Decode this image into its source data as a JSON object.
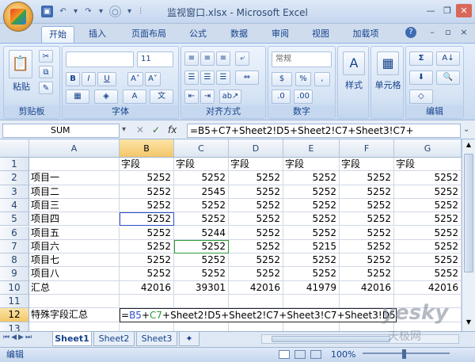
{
  "title": "监视窗口.xlsx - Microsoft Excel",
  "tabs": [
    "开始",
    "插入",
    "页面布局",
    "公式",
    "数据",
    "审阅",
    "视图",
    "加载项"
  ],
  "ribbon": {
    "clipboard": {
      "label": "剪贴板",
      "paste": "粘贴"
    },
    "font": {
      "label": "字体",
      "size": "11"
    },
    "alignment": {
      "label": "对齐方式"
    },
    "number": {
      "label": "数字",
      "format": "常规"
    },
    "styles": {
      "label": "样式"
    },
    "cells": {
      "label": "单元格"
    },
    "editing": {
      "label": "编辑"
    }
  },
  "name_box": "SUM",
  "fx_label": "fx",
  "formula": "=B5+C7+Sheet2!D5+Sheet2!C7+Sheet3!C7+",
  "columns": [
    "A",
    "B",
    "C",
    "D",
    "E",
    "F",
    "G"
  ],
  "rows": [
    {
      "n": "1",
      "a": "",
      "vals": [
        "字段",
        "字段",
        "字段",
        "字段",
        "字段",
        "字段"
      ]
    },
    {
      "n": "2",
      "a": "项目一",
      "vals": [
        "5252",
        "5252",
        "5252",
        "5252",
        "5252",
        "5252"
      ]
    },
    {
      "n": "3",
      "a": "项目二",
      "vals": [
        "5252",
        "2545",
        "5252",
        "5252",
        "5252",
        "5252"
      ]
    },
    {
      "n": "4",
      "a": "项目三",
      "vals": [
        "5252",
        "5252",
        "5252",
        "5252",
        "5252",
        "5252"
      ]
    },
    {
      "n": "5",
      "a": "项目四",
      "vals": [
        "5252",
        "5252",
        "5252",
        "5252",
        "5252",
        "5252"
      ]
    },
    {
      "n": "6",
      "a": "项目五",
      "vals": [
        "5252",
        "5244",
        "5252",
        "5252",
        "5252",
        "5252"
      ]
    },
    {
      "n": "7",
      "a": "项目六",
      "vals": [
        "5252",
        "5252",
        "5252",
        "5215",
        "5252",
        "5252"
      ]
    },
    {
      "n": "8",
      "a": "项目七",
      "vals": [
        "5252",
        "5252",
        "5252",
        "5252",
        "5252",
        "5252"
      ]
    },
    {
      "n": "9",
      "a": "项目八",
      "vals": [
        "5252",
        "5252",
        "5252",
        "5252",
        "5252",
        "5252"
      ]
    },
    {
      "n": "10",
      "a": "汇总",
      "vals": [
        "42016",
        "39301",
        "42016",
        "41979",
        "42016",
        "42016"
      ]
    },
    {
      "n": "11",
      "a": "",
      "vals": [
        "",
        "",
        "",
        "",
        "",
        ""
      ]
    },
    {
      "n": "12",
      "a": "特殊字段汇总",
      "vals": [
        "",
        "",
        "",
        "",
        "",
        ""
      ]
    },
    {
      "n": "13",
      "a": "",
      "vals": [
        "",
        "",
        "",
        "",
        "",
        ""
      ]
    }
  ],
  "edit_formula": {
    "eq": "=",
    "r1": "B5",
    "plus": "+",
    "r2": "C7",
    "rest": "+Sheet2!D5+Sheet2!C7+Sheet3!C7+Sheet3!D5"
  },
  "sheets": [
    "Sheet1",
    "Sheet2",
    "Sheet3"
  ],
  "status": {
    "mode": "编辑",
    "zoom": "100%"
  },
  "watermark": {
    "brand": "yesky",
    "sub": "天极网"
  }
}
